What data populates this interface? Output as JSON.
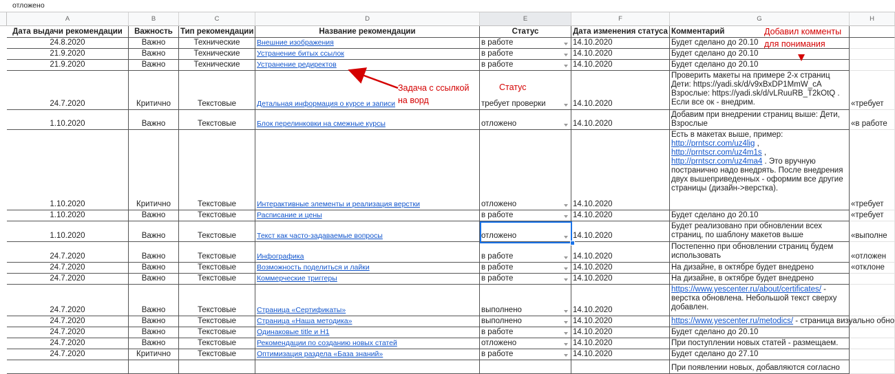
{
  "formula_bar": {
    "value": "отложено"
  },
  "column_letters": [
    "A",
    "B",
    "C",
    "D",
    "E",
    "F",
    "G",
    "H"
  ],
  "headers": {
    "a": "Дата выдачи рекомендации",
    "b": "Важность",
    "c": "Тип рекомендации",
    "d": "Название рекомендации",
    "e": "Статус",
    "f": "Дата изменения статуса",
    "g": "Комментарий"
  },
  "rows": [
    {
      "a": "24.8.2020",
      "b": "Важно",
      "c": "Технические",
      "d": "Внешние изображения",
      "e": "в работе",
      "f": "14.10.2020",
      "g": "Будет сделано до 20.10",
      "h": ""
    },
    {
      "a": "21.9.2020",
      "b": "Важно",
      "c": "Технические",
      "d": "Устранение битых ссылок",
      "e": "в работе",
      "f": "14.10.2020",
      "g": "Будет сделано до 20.10",
      "h": ""
    },
    {
      "a": "21.9.2020",
      "b": "Важно",
      "c": "Технические",
      "d": "Устранение редиректов",
      "e": "в работе",
      "f": "14.10.2020",
      "g": "Будет сделано до 20.10",
      "h": ""
    },
    {
      "a": "24.7.2020",
      "b": "Критично",
      "c": "Текстовые",
      "d": "Детальная информация о курсе и записи",
      "e": "требует проверки",
      "f": "14.10.2020",
      "g": "Проверить макеты на примере 2-х страниц\nДети: https://yadi.sk/d/v9xBxDP1MmW_cA\nВзрослые: https://yadi.sk/d/vLRuuRB_T2kOtQ .\nЕсли все ок - внедрим.",
      "h": "«требует"
    },
    {
      "a": "1.10.2020",
      "b": "Важно",
      "c": "Текстовые",
      "d": "Блок перелинковки на смежные курсы",
      "e": "отложено",
      "f": "14.10.2020",
      "g": "Добавим при внедрении страниц выше: Дети,\nВзрослые",
      "h": "«в работе"
    },
    {
      "a": "1.10.2020",
      "b": "Критично",
      "c": "Текстовые",
      "d": "Интерактивные элементы и реализация верстки",
      "e": "отложено",
      "f": "14.10.2020",
      "g_pre": "Есть в макетах выше, пример:",
      "g_links": [
        "http://prntscr.com/uz4lig",
        "http://prntscr.com/uz4m1s",
        "http://prntscr.com/uz4ma4"
      ],
      "g_post": ". Это вручную постранично надо внедрять. После внедрения двух вышеприведенных - оформим все другие страницы (дизайн->верстка).",
      "h": "«требует"
    },
    {
      "a": "1.10.2020",
      "b": "Важно",
      "c": "Текстовые",
      "d": "Расписание и цены",
      "e": "в работе",
      "f": "14.10.2020",
      "g": "Будет сделано до 20.10",
      "h": "«требует"
    },
    {
      "a": "1.10.2020",
      "b": "Важно",
      "c": "Текстовые",
      "d": "Текст как часто-задаваемые вопросы",
      "e": "отложено",
      "f": "14.10.2020",
      "g": "Будет реализовано при обновлении всех\nстраниц, по шаблону макетов выше",
      "h": "«выполне"
    },
    {
      "a": "24.7.2020",
      "b": "Важно",
      "c": "Текстовые",
      "d": "Инфографика",
      "e": "в работе",
      "f": "14.10.2020",
      "g": "Постепенно при обновлении страниц будем\nиспользовать",
      "h": "«отложен"
    },
    {
      "a": "24.7.2020",
      "b": "Важно",
      "c": "Текстовые",
      "d": "Возможность поделиться и лайки",
      "e": "в работе",
      "f": "14.10.2020",
      "g": "На дизайне, в октябре будет внедрено",
      "h": "«отклоне"
    },
    {
      "a": "24.7.2020",
      "b": "Важно",
      "c": "Текстовые",
      "d": "Коммерческие триггеры",
      "e": "в работе",
      "f": "14.10.2020",
      "g": "На дизайне, в октябре будет внедрено",
      "h": ""
    },
    {
      "a": "24.7.2020",
      "b": "Важно",
      "c": "Текстовые",
      "d": "Страница «Сертификаты»",
      "e": "выполнено",
      "f": "14.10.2020",
      "g_link": "https://www.yescenter.ru/about/certificates/",
      "g_after": " - верстка обновлена. Небольшой текст сверху добавлен.",
      "h": ""
    },
    {
      "a": "24.7.2020",
      "b": "Важно",
      "c": "Текстовые",
      "d": "Страница «Наша методика»",
      "e": "выполнено",
      "f": "14.10.2020",
      "g_link": "https://www.yescenter.ru/metodics/",
      "g_after": " - страница визуально обно",
      "h": ""
    },
    {
      "a": "24.7.2020",
      "b": "Важно",
      "c": "Текстовые",
      "d": "Одинаковые title и H1",
      "e": "в работе",
      "f": "14.10.2020",
      "g": "Будет сделано до 20.10",
      "h": ""
    },
    {
      "a": "24.7.2020",
      "b": "Важно",
      "c": "Текстовые",
      "d": "Рекомендации по созданию новых статей",
      "e": "отложено",
      "f": "14.10.2020",
      "g": "При поступлении новых статей - размещаем.",
      "h": ""
    },
    {
      "a": "24.7.2020",
      "b": "Критично",
      "c": "Текстовые",
      "d": "Оптимизация раздела «База знаний»",
      "e": "в работе",
      "f": "14.10.2020",
      "g": "Будет сделано до 27.10",
      "h": ""
    },
    {
      "a": "",
      "b": "",
      "c": "",
      "d": "",
      "e": "",
      "f": "",
      "g": "При появлении новых, добавляются согласно",
      "h": ""
    }
  ],
  "annotations": {
    "comments_note": "Добавил комменты\nдля понимания",
    "task_note": "Задача с ссылкой\nна ворд",
    "status_note": "Статус"
  },
  "colors": {
    "annotation": "#d40000",
    "link": "#1155cc",
    "selection": "#1a73e8"
  }
}
